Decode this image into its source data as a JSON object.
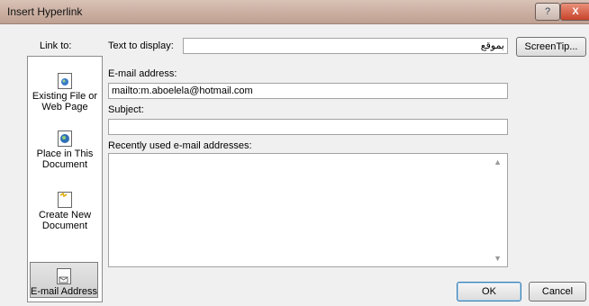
{
  "window": {
    "title": "Insert Hyperlink",
    "help_label": "?",
    "close_label": "X"
  },
  "link_to": {
    "label": "Link to:",
    "items": [
      {
        "label": "Existing File or Web Page",
        "icon": "globe-file-icon"
      },
      {
        "label": "Place in This Document",
        "icon": "document-globe-icon"
      },
      {
        "label": "Create New Document",
        "icon": "new-document-icon"
      },
      {
        "label": "E-mail Address",
        "icon": "email-document-icon",
        "selected": true
      }
    ]
  },
  "text_to_display": {
    "label": "Text to display:",
    "value": "بموقع"
  },
  "screentip_label": "ScreenTip...",
  "email_address": {
    "label": "E-mail address:",
    "value": "mailto:m.aboelela@hotmail.com"
  },
  "subject": {
    "label": "Subject:",
    "value": ""
  },
  "recent": {
    "label": "Recently used e-mail addresses:",
    "items": []
  },
  "buttons": {
    "ok": "OK",
    "cancel": "Cancel"
  }
}
